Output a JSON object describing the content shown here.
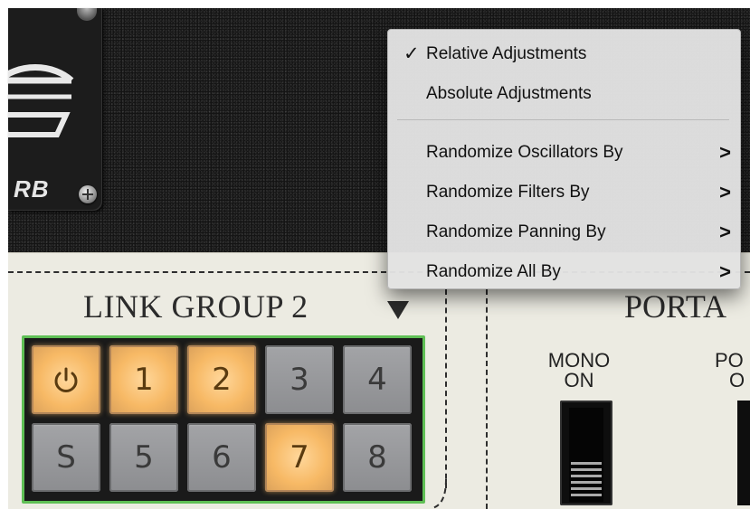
{
  "plate": {
    "text": "RB",
    "logo_icon": "e-logo-icon",
    "screw_icon": "screw-icon"
  },
  "menu": {
    "items": [
      {
        "label": "Relative Adjustments",
        "checked": true,
        "check_glyph": "✓"
      },
      {
        "label": "Absolute Adjustments",
        "checked": false
      }
    ],
    "submenus": [
      {
        "label": "Randomize Oscillators By",
        "chevron": ">"
      },
      {
        "label": "Randomize Filters By",
        "chevron": ">"
      },
      {
        "label": "Randomize Panning By",
        "chevron": ">"
      },
      {
        "label": "Randomize All By",
        "chevron": ">"
      }
    ]
  },
  "link_group": {
    "title": "LINK GROUP 2",
    "arrow_icon": "triangle-down-icon",
    "buttons": [
      {
        "label": "",
        "icon": "power-icon",
        "active": true
      },
      {
        "label": "1",
        "active": true
      },
      {
        "label": "2",
        "active": true
      },
      {
        "label": "3",
        "active": false
      },
      {
        "label": "4",
        "active": false
      },
      {
        "label": "S",
        "active": false
      },
      {
        "label": "5",
        "active": false
      },
      {
        "label": "6",
        "active": false
      },
      {
        "label": "7",
        "active": true
      },
      {
        "label": "8",
        "active": false
      }
    ]
  },
  "porta": {
    "title": "PORTA",
    "mono_label_line1": "MONO",
    "mono_label_line2": "ON",
    "po_label_line1": "PO",
    "po_label_line2": "O"
  },
  "colors": {
    "active_button": "#f7b965",
    "inactive_button": "#9a9b9e",
    "grid_border": "#5fbf55",
    "panel": "#ecebe2",
    "menu_bg": "#e2e2e2"
  }
}
